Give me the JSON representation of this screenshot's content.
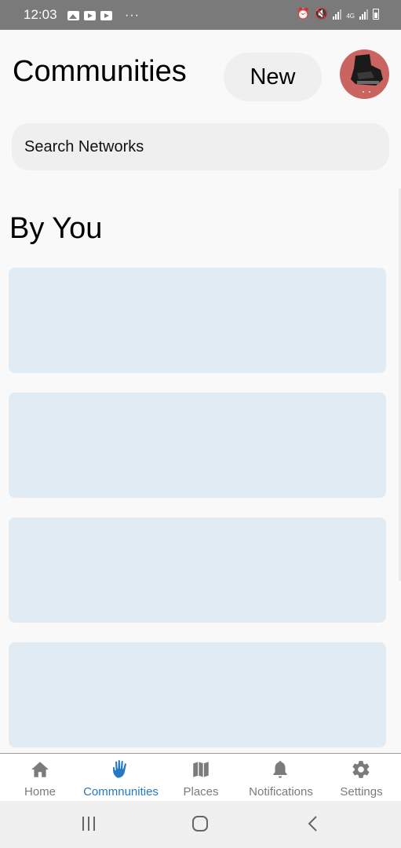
{
  "status_bar": {
    "time": "12:03",
    "left_icons": [
      "gallery-icon",
      "youtube-icon",
      "youtube-icon"
    ],
    "more": "···",
    "right_icons": [
      "alarm-icon",
      "mute-icon",
      "signal-icon",
      "4g-icon",
      "signal-icon",
      "battery-icon"
    ],
    "network": "4G"
  },
  "header": {
    "title": "Communities",
    "new_label": "New",
    "avatar_icon": "profile-avatar"
  },
  "search": {
    "placeholder": "Search Networks"
  },
  "section": {
    "heading": "By You"
  },
  "cards": [
    {
      "state": "loading-placeholder"
    },
    {
      "state": "loading-placeholder"
    },
    {
      "state": "loading-placeholder"
    },
    {
      "state": "loading-placeholder"
    }
  ],
  "bottom_nav": {
    "items": [
      {
        "label": "Home",
        "icon": "home-icon",
        "active": false
      },
      {
        "label": "Commnunities",
        "icon": "hand-icon",
        "active": true
      },
      {
        "label": "Places",
        "icon": "map-icon",
        "active": false
      },
      {
        "label": "Notifications",
        "icon": "bell-icon",
        "active": false
      },
      {
        "label": "Settings",
        "icon": "gear-icon",
        "active": false
      }
    ]
  },
  "system_nav": {
    "buttons": [
      "recent-apps-icon",
      "home-circle-icon",
      "back-icon"
    ]
  },
  "colors": {
    "accent": "#2479c2",
    "card": "#e1ebf4",
    "avatar_bg": "#c96460",
    "inactive": "#7b7b7b"
  }
}
